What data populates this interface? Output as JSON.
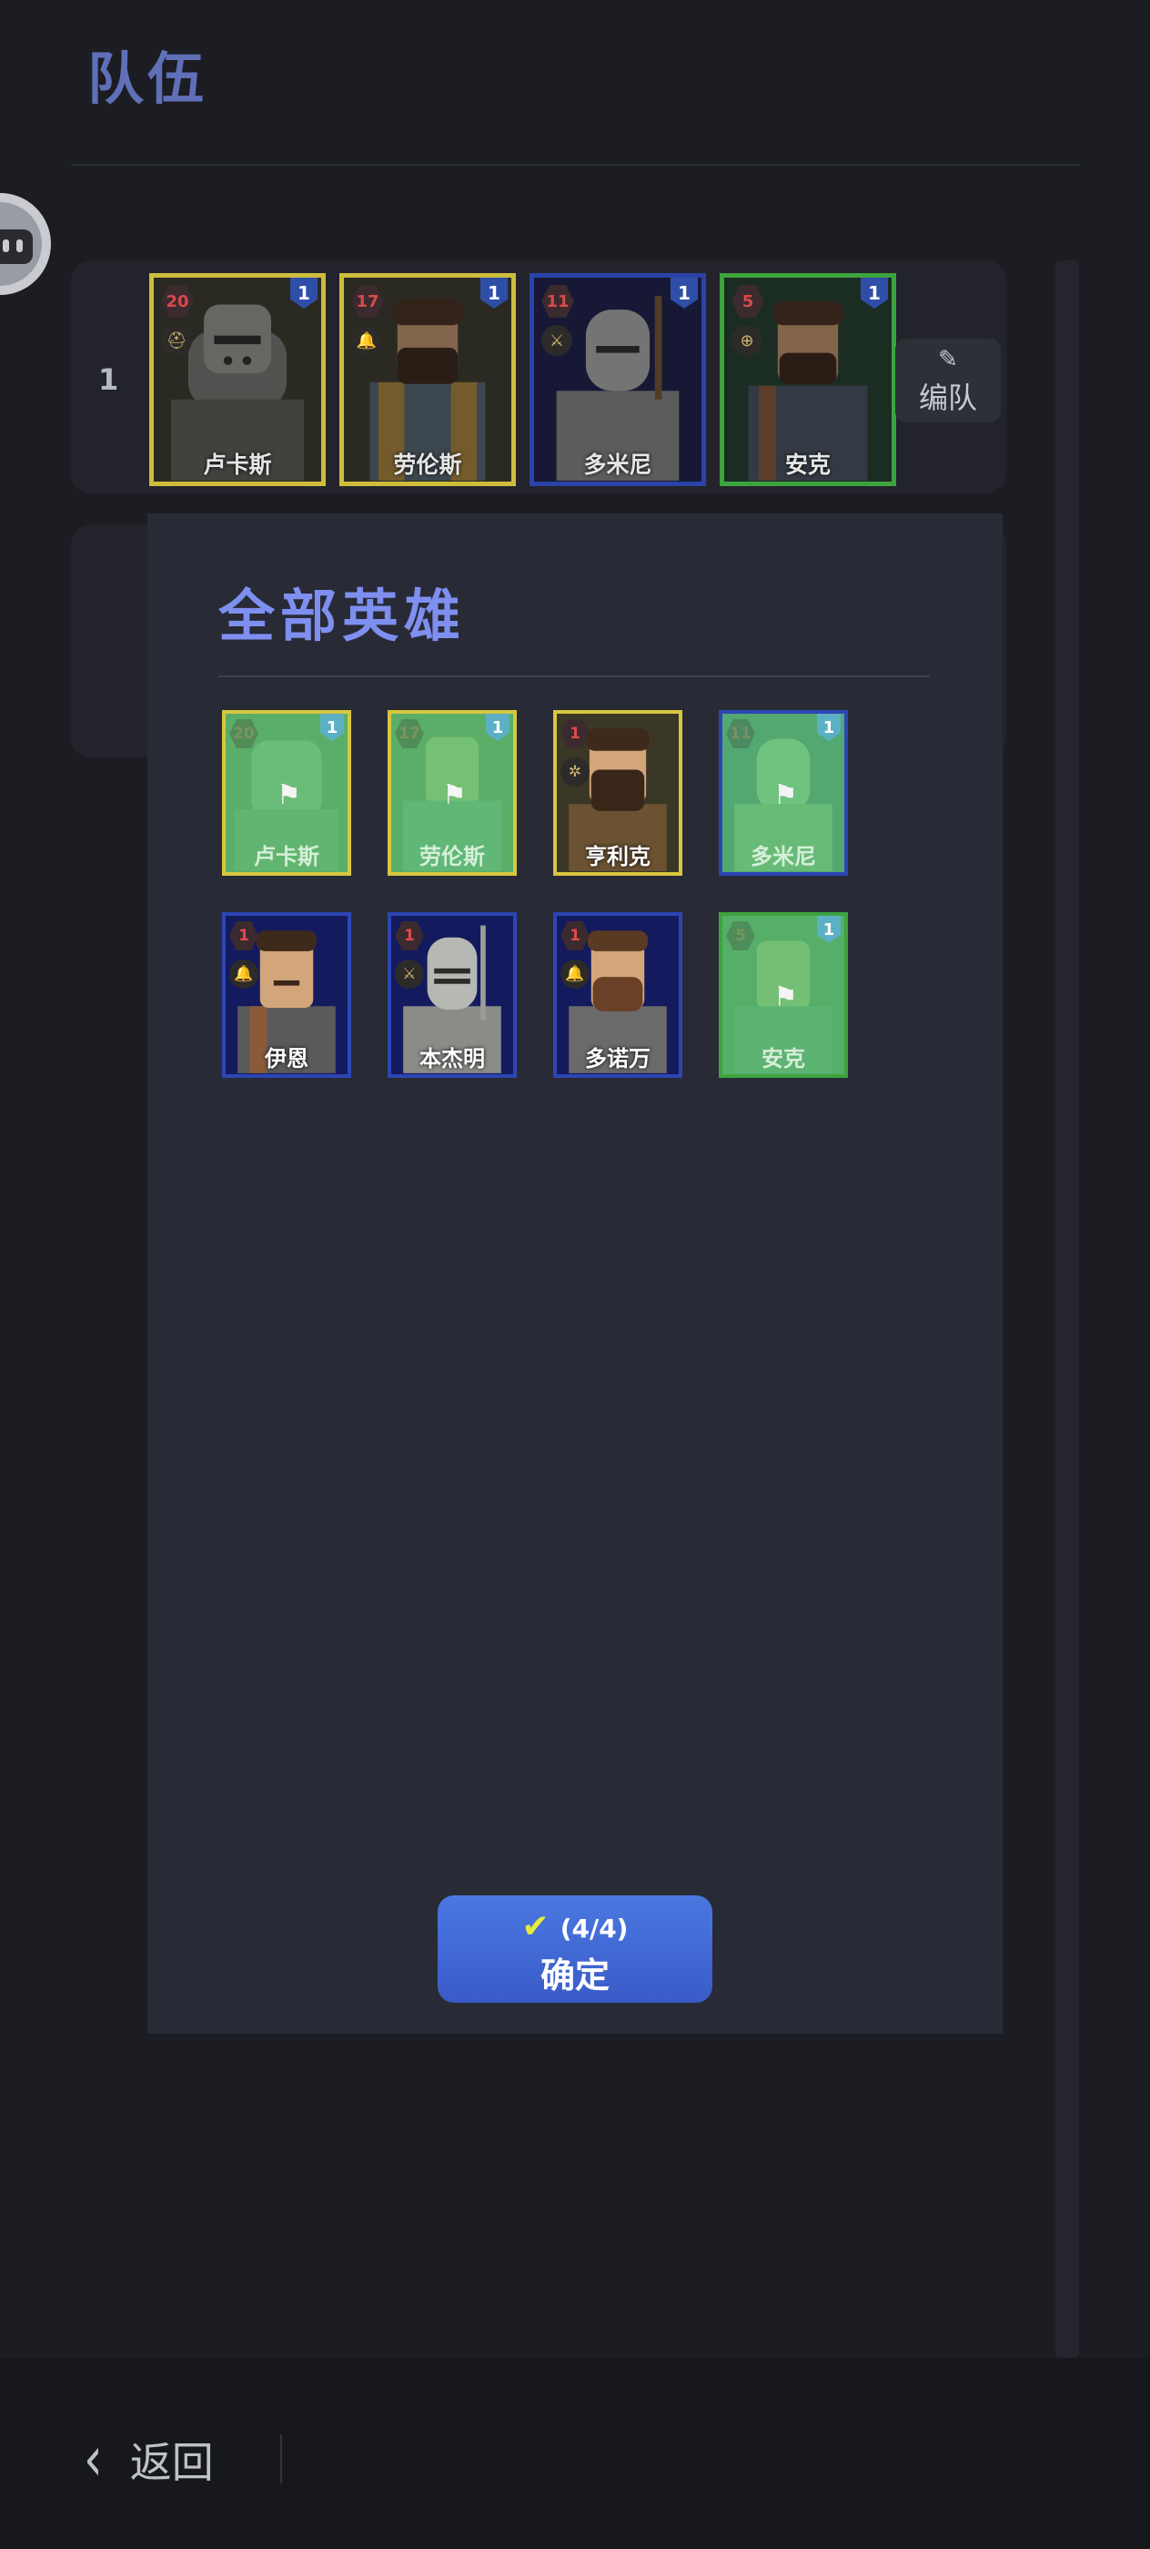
{
  "header": {
    "title": "队伍"
  },
  "team": {
    "index": "1",
    "edit_label": "编队",
    "members": [
      {
        "name": "卢卡斯",
        "level": "20",
        "badge": "1",
        "border": "yellow"
      },
      {
        "name": "劳伦斯",
        "level": "17",
        "badge": "1",
        "border": "yellow"
      },
      {
        "name": "多米尼",
        "level": "11",
        "badge": "1",
        "border": "blue"
      },
      {
        "name": "安克",
        "level": "5",
        "badge": "1",
        "border": "green"
      }
    ]
  },
  "modal": {
    "title": "全部英雄",
    "heroes": [
      {
        "name": "卢卡斯",
        "level": "20",
        "badge": "1",
        "selected": true
      },
      {
        "name": "劳伦斯",
        "level": "17",
        "badge": "1",
        "selected": true
      },
      {
        "name": "亨利克",
        "level": "1",
        "badge": "",
        "selected": false
      },
      {
        "name": "多米尼",
        "level": "11",
        "badge": "1",
        "selected": true
      },
      {
        "name": "伊恩",
        "level": "1",
        "badge": "",
        "selected": false
      },
      {
        "name": "本杰明",
        "level": "1",
        "badge": "",
        "selected": false
      },
      {
        "name": "多诺万",
        "level": "1",
        "badge": "",
        "selected": false
      },
      {
        "name": "安克",
        "level": "5",
        "badge": "1",
        "selected": true
      }
    ],
    "confirm": {
      "count": "(4/4)",
      "label": "确定"
    }
  },
  "footer": {
    "back_label": "返回"
  },
  "colors": {
    "accent": "#7e8ff0",
    "selected_overlay": "#62c876",
    "confirm": "#4a6fd8"
  }
}
